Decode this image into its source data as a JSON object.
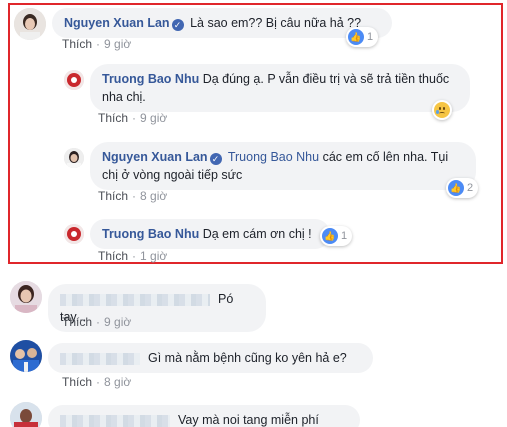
{
  "comments": [
    {
      "author": "Nguyen Xuan Lan",
      "verified": true,
      "text": "Là sao em?? Bị câu nữa hả ??",
      "like_label": "Thích",
      "time": "9 giờ",
      "reaction_count": "1"
    },
    {
      "author": "Truong Bao Nhu",
      "text": "Dạ đúng ạ. P vẫn điều trị và sẽ trả tiền thuốc nha chị.",
      "like_label": "Thích",
      "time": "9 giờ"
    },
    {
      "author": "Nguyen Xuan Lan",
      "verified": true,
      "mention": "Truong Bao Nhu",
      "text": "các em cố lên nha. Tụi chị ở vòng ngoài tiếp sức",
      "like_label": "Thích",
      "time": "8 giờ",
      "reaction_count": "2"
    },
    {
      "author": "Truong Bao Nhu",
      "text": "Dạ em cám ơn chị !",
      "like_label": "Thích",
      "time": "1 giờ",
      "reaction_count": "1"
    },
    {
      "text": "Pó tay...",
      "like_label": "Thích",
      "time": "9 giờ"
    },
    {
      "text": "Gì mà nằm bệnh cũng ko yên hả e?",
      "like_label": "Thích",
      "time": "8 giờ"
    },
    {
      "text": "Vay mà noi tang miễn phí"
    }
  ],
  "colors": {
    "author": "#365899",
    "highlight_border": "#e0262b",
    "bubble_bg": "#f2f3f5",
    "meta": "#90949c"
  }
}
